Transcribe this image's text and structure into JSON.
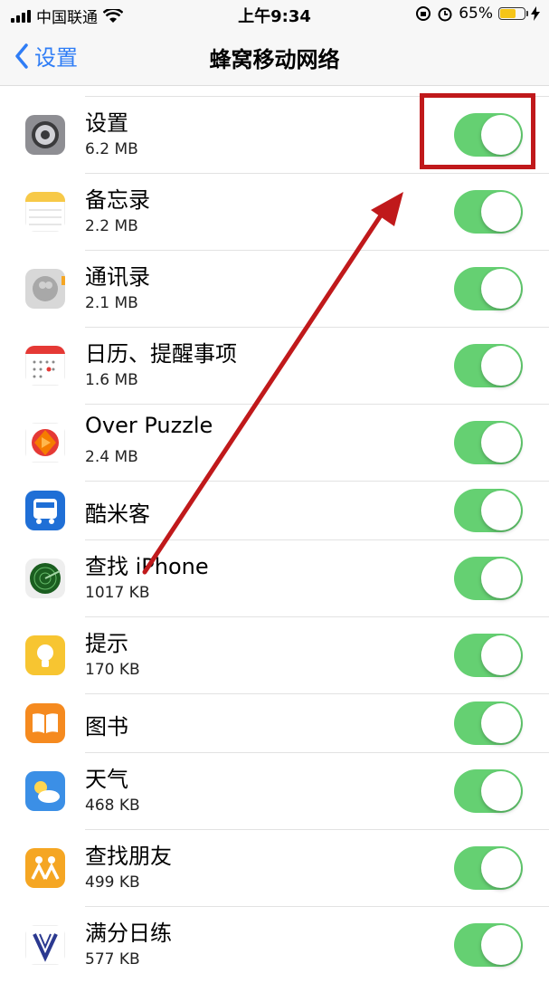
{
  "status_bar": {
    "carrier": "中国联通",
    "time": "上午9:34",
    "battery": "65%",
    "battery_level": 0.65
  },
  "nav": {
    "back_label": "设置",
    "title": "蜂窝移动网络"
  },
  "apps": [
    {
      "name": "设置",
      "size": "6.2 MB",
      "icon": "settings-gear-icon",
      "enabled": true
    },
    {
      "name": "备忘录",
      "size": "2.2 MB",
      "icon": "notes-icon",
      "enabled": true
    },
    {
      "name": "通讯录",
      "size": "2.1 MB",
      "icon": "contacts-icon",
      "enabled": true
    },
    {
      "name": "日历、提醒事项",
      "size": "1.6 MB",
      "icon": "calendar-icon",
      "enabled": true
    },
    {
      "name": "Over Puzzle",
      "size": "2.4 MB",
      "icon": "puzzle-icon",
      "enabled": true
    },
    {
      "name": "酷米客",
      "size": "",
      "icon": "bus-icon",
      "enabled": true
    },
    {
      "name": "查找 iPhone",
      "size": "1017 KB",
      "icon": "find-iphone-radar-icon",
      "enabled": true
    },
    {
      "name": "提示",
      "size": "170 KB",
      "icon": "tips-lightbulb-icon",
      "enabled": true
    },
    {
      "name": "图书",
      "size": "",
      "icon": "books-icon",
      "enabled": true
    },
    {
      "name": "天气",
      "size": "468 KB",
      "icon": "weather-icon",
      "enabled": true
    },
    {
      "name": "查找朋友",
      "size": "499 KB",
      "icon": "find-friends-icon",
      "enabled": true
    },
    {
      "name": "满分日练",
      "size": "577 KB",
      "icon": "daily-practice-icon",
      "enabled": true
    }
  ],
  "colors": {
    "toggle_on": "#65d072",
    "accent": "#2f7df6",
    "annotation": "#c0191b"
  }
}
